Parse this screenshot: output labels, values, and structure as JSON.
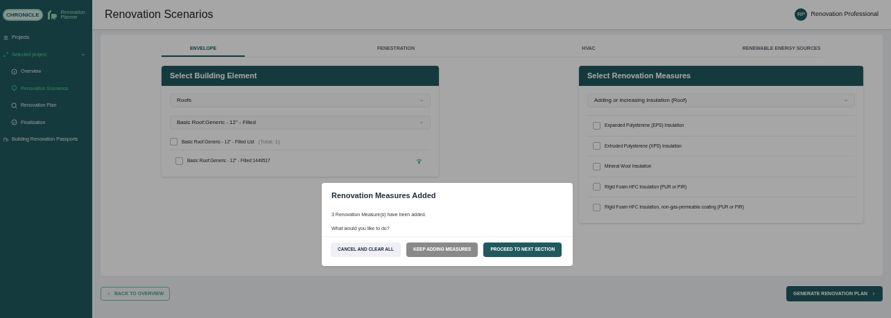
{
  "sidebar": {
    "logos": {
      "partner": "CHRONICLE",
      "app": "Renovation Planner"
    },
    "items": [
      {
        "kind": "top",
        "label": "Projects",
        "selected": false
      },
      {
        "kind": "group",
        "label": "Selected project",
        "selected": true,
        "expanded": true
      },
      {
        "kind": "sub",
        "label": "Overview",
        "selected": false
      },
      {
        "kind": "sub",
        "label": "Renovation Scenarios",
        "selected": true
      },
      {
        "kind": "sub",
        "label": "Renovation Plan",
        "selected": false
      },
      {
        "kind": "sub",
        "label": "Finalization",
        "selected": false
      },
      {
        "kind": "top",
        "label": "Building Renovation Passports",
        "selected": false
      }
    ]
  },
  "header": {
    "title": "Renovation Scenarios",
    "user": {
      "initials": "RP",
      "name": "Renovation Professional"
    }
  },
  "tabs": [
    {
      "label": "ENVELOPE",
      "selected": true
    },
    {
      "label": "FENESTRATION",
      "selected": false
    },
    {
      "label": "HVAC",
      "selected": false
    },
    {
      "label": "RENEWABLE ENERGY SOURCES",
      "selected": false
    }
  ],
  "building_element": {
    "title": "Select Building Element",
    "selects": [
      "Roofs",
      "Basic Roof:Generic - 12\" - Filled"
    ],
    "list": {
      "label": "Basic Roof:Generic - 12\" - Filled List",
      "total": "(Total: 1)",
      "checked": false,
      "items": [
        {
          "label": "Basic Roof:Generic - 12\" - Filled:1449517",
          "checked": false
        }
      ]
    }
  },
  "measures": {
    "title": "Select Renovation Measures",
    "select": "Adding or increasing insulation (Roof)",
    "options": [
      {
        "label": "Expanded Polysterene (EPS) Insulation",
        "checked": false
      },
      {
        "label": "Extruded Polysterene (XPS) Insulation",
        "checked": false
      },
      {
        "label": "Mineral Wool Insulation",
        "checked": false
      },
      {
        "label": "Rigid Foam HFC Insulation (PUR or PIR)",
        "checked": false
      },
      {
        "label": "Rigid Foam HFC Insulation, non-gas-permeable coating (PUR or PIR)",
        "checked": false
      }
    ]
  },
  "footer": {
    "back": "BACK TO OVERVIEW",
    "next": "GENERATE RENOVATION PLAN"
  },
  "dialog": {
    "title": "Renovation Measures Added",
    "lines": [
      "3 Renovation Measure(s) have been added.",
      "What would you like to do?"
    ],
    "buttons": [
      {
        "kind": "light",
        "label": "CANCEL AND CLEAR ALL"
      },
      {
        "kind": "grey",
        "label": "KEEP ADDING MEASURES"
      },
      {
        "kind": "primary",
        "label": "PROCEED TO NEXT SECTION"
      }
    ]
  }
}
